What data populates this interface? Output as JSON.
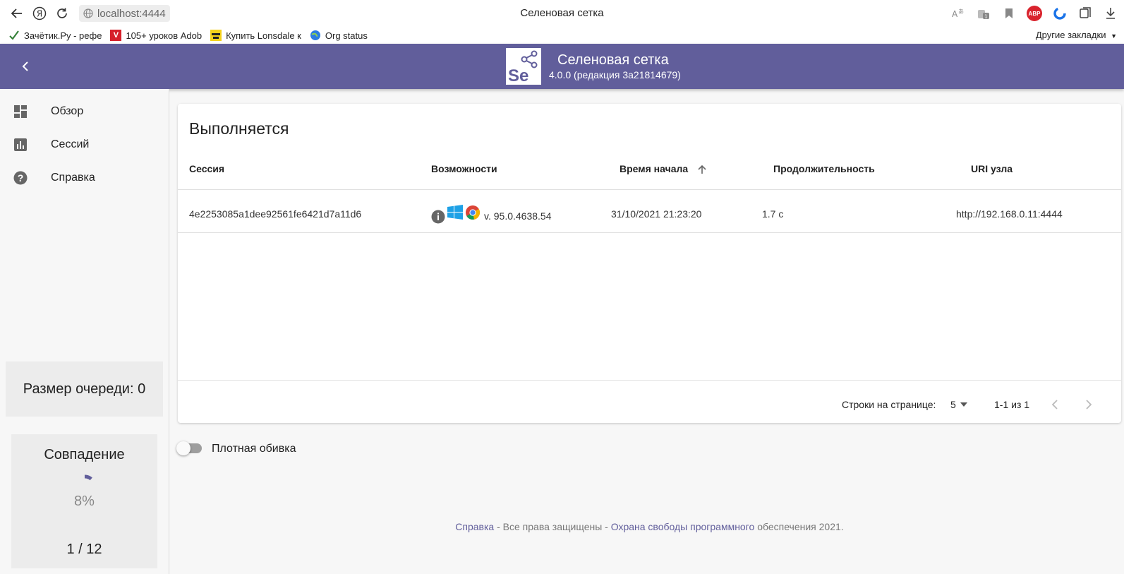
{
  "browser": {
    "url": "localhost:4444",
    "tab_title": "Селеновая сетка",
    "bookmarks": [
      {
        "label": "Зачётик.Ру - рефе",
        "icon": "check-icon"
      },
      {
        "label": "105+ уроков Adob",
        "icon": "v-logo-icon"
      },
      {
        "label": "Купить Lonsdale к",
        "icon": "spy-icon"
      },
      {
        "label": "Org status",
        "icon": "globe-icon"
      }
    ],
    "other_bookmarks": "Другие закладки",
    "adblock_label": "ABP"
  },
  "header": {
    "logo_text": "Se",
    "title": "Селеновая сетка",
    "subtitle": "4.0.0 (редакция 3a21814679)",
    "accent": "#615e9b"
  },
  "sidebar": {
    "items": [
      {
        "label": "Обзор",
        "icon": "dashboard-icon"
      },
      {
        "label": "Сессий",
        "icon": "bar-chart-icon"
      },
      {
        "label": "Справка",
        "icon": "help-icon"
      }
    ],
    "queue": "Размер очереди: 0",
    "match": {
      "title": "Совпадение",
      "percent_text": "8%",
      "percent_value": 8,
      "count": "1 / 12"
    }
  },
  "main": {
    "title": "Выполняется",
    "columns": [
      "Сессия",
      "Возможности",
      "Время начала",
      "Продолжительность",
      "URI узла"
    ],
    "rows": [
      {
        "session": "4e2253085a1dee92561fe6421d7a11d6",
        "capabilities": {
          "info_icon": "info-icon",
          "os_icon": "windows-icon",
          "browser_icon": "chrome-icon",
          "version": "v. 95.0.4638.54"
        },
        "start_time": "31/10/2021 21:23:20",
        "duration": "1.7 с",
        "uri": "http://192.168.0.11:4444"
      }
    ],
    "pagination": {
      "rows_per_page_label": "Строки на странице:",
      "rows_per_page": "5",
      "range": "1-1 из 1"
    }
  },
  "dense": {
    "label": "Плотная обивка",
    "checked": false
  },
  "footer": {
    "help_link": "Справка",
    "sep1": " - Все права защищены - ",
    "sfc_link": "Охрана свободы программного",
    "tail": " обеспечения 2021."
  }
}
